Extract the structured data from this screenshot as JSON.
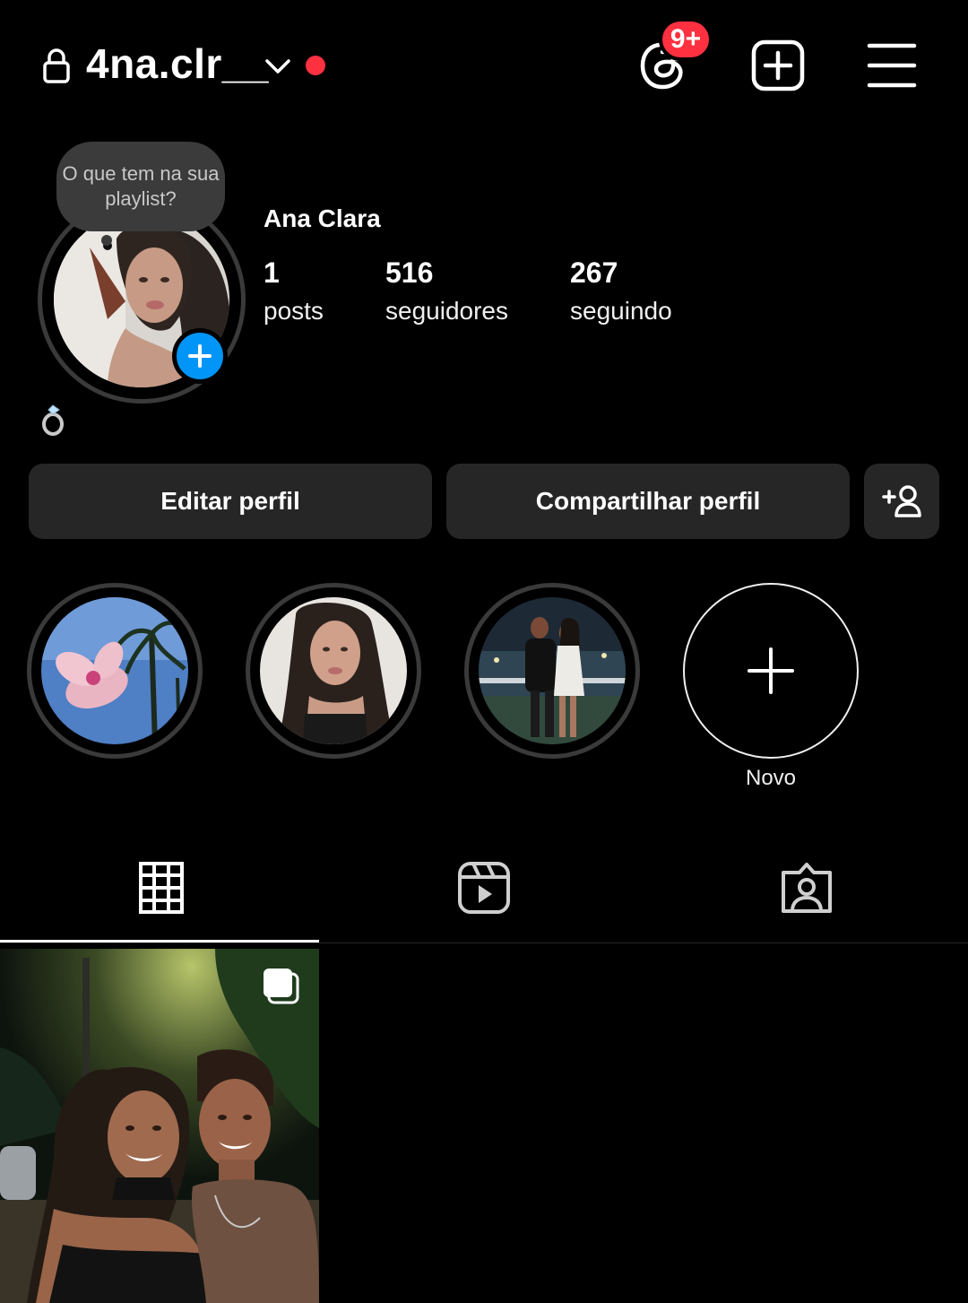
{
  "header": {
    "username": "4na.clr__",
    "notification_badge": "9+",
    "icons": [
      "lock-icon",
      "chevron-down-icon",
      "threads-icon",
      "create-plus-icon",
      "hamburger-menu-icon"
    ]
  },
  "profile": {
    "note": "O que tem na sua playlist?",
    "display_name": "Ana Clara",
    "bio_emoji": "💍",
    "stats": [
      {
        "value": "1",
        "label": "posts"
      },
      {
        "value": "516",
        "label": "seguidores"
      },
      {
        "value": "267",
        "label": "seguindo"
      }
    ]
  },
  "actions": {
    "edit_label": "Editar perfil",
    "share_label": "Compartilhar perfil"
  },
  "highlights": {
    "new_label": "Novo"
  },
  "tabs": [
    "grid-icon",
    "reels-icon",
    "tagged-icon"
  ],
  "colors": {
    "background": "#000000",
    "button_bg": "#262626",
    "badge_red": "#ff3040",
    "accent_blue": "#0095f6",
    "live_dot": "#ff3040"
  }
}
